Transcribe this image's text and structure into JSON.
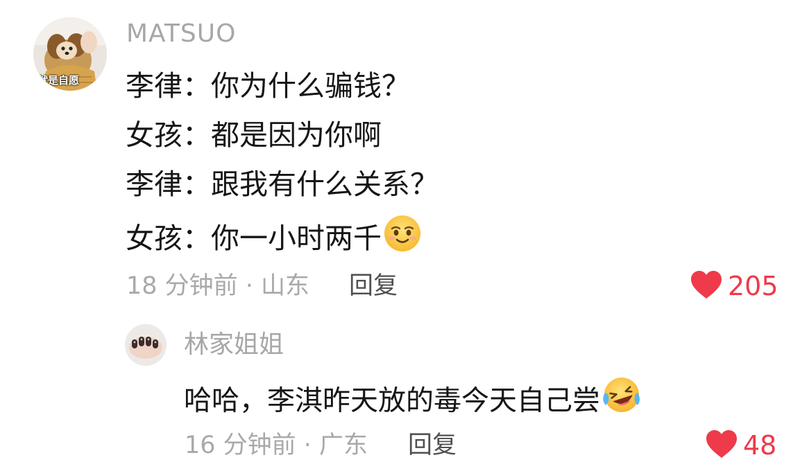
{
  "main_comment": {
    "username": "MATSUO",
    "avatar_caption": "就是自愿",
    "lines": [
      {
        "speaker": "李律：",
        "text": "你为什么骗钱？"
      },
      {
        "speaker": "女孩：",
        "text": "都是因为你啊"
      },
      {
        "speaker": "李律：",
        "text": "跟我有什么关系？"
      },
      {
        "speaker": "女孩：",
        "text": "你一小时两千"
      }
    ],
    "emoji": "smirk-face-emoji",
    "time_location": "18 分钟前 · 山东",
    "reply_label": "回复",
    "like_count": "205"
  },
  "reply_comment": {
    "username": "林家姐姐",
    "text": "哈哈，李淇昨天放的毒今天自己尝",
    "emoji": "laughing-tears-emoji",
    "time_location": "16 分钟前 · 广东",
    "reply_label": "回复",
    "like_count": "48"
  },
  "colors": {
    "like_red": "#ee3a4a",
    "meta_gray": "#a9a9a9",
    "text_dark": "#161616"
  }
}
